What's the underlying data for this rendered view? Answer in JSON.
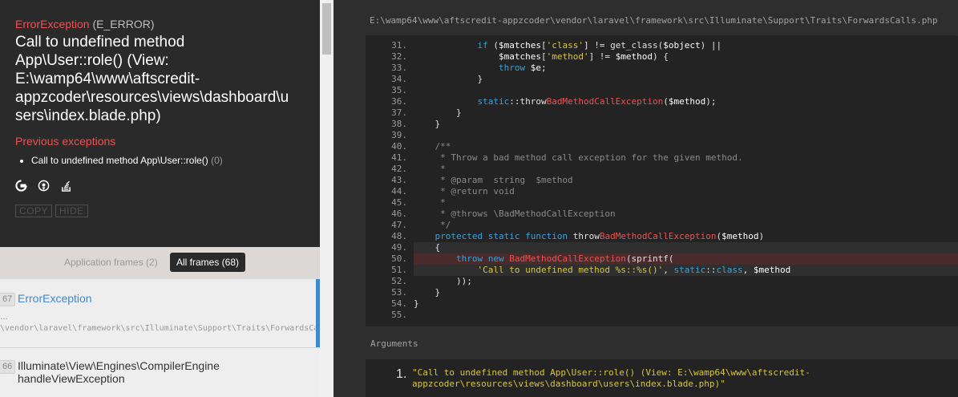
{
  "exception": {
    "class_name": "ErrorException",
    "severity": "(E_ERROR)",
    "message": "Call to undefined method App\\User::role() (View: E:\\wamp64\\www\\aftscredit-appzcoder\\resources\\views\\dashboard\\users\\index.blade.php)",
    "previous_title": "Previous exceptions",
    "previous": [
      {
        "text": "Call to undefined method App\\User::role()",
        "code": "(0)"
      }
    ],
    "search_icons": [
      "google-icon",
      "duckduckgo-icon",
      "stackoverflow-icon"
    ],
    "copy_label": "COPY",
    "hide_label": "HIDE"
  },
  "frames_controls": {
    "application_label": "Application frames (2)",
    "all_label": "All frames (68)"
  },
  "frames": [
    {
      "index": "67",
      "class": "ErrorException",
      "ellipsis": "…",
      "file": "\\vendor\\laravel\\framework\\src\\Illuminate\\Support\\Traits\\ForwardsCalls.php"
    },
    {
      "index": "66",
      "class": "Illuminate\\View\\Engines\\CompilerEngine",
      "function": "handleViewException"
    }
  ],
  "code": {
    "file_path": "E:\\wamp64\\www\\aftscredit-appzcoder\\vendor\\laravel\\framework\\src\\Illuminate\\Support\\Traits\\ForwardsCalls.php",
    "highlighted_line": 50,
    "lines": [
      {
        "n": "31.",
        "t": "            if ($matches['class'] != get_class($object) ||"
      },
      {
        "n": "32.",
        "t": "                $matches['method'] != $method) {"
      },
      {
        "n": "33.",
        "t": "                throw $e;"
      },
      {
        "n": "34.",
        "t": "            }"
      },
      {
        "n": "35.",
        "t": ""
      },
      {
        "n": "36.",
        "t": "            static::throwBadMethodCallException($method);"
      },
      {
        "n": "37.",
        "t": "        }"
      },
      {
        "n": "38.",
        "t": "    }"
      },
      {
        "n": "39.",
        "t": ""
      },
      {
        "n": "40.",
        "t": "    /**"
      },
      {
        "n": "41.",
        "t": "     * Throw a bad method call exception for the given method."
      },
      {
        "n": "42.",
        "t": "     *"
      },
      {
        "n": "43.",
        "t": "     * @param  string  $method"
      },
      {
        "n": "44.",
        "t": "     * @return void"
      },
      {
        "n": "45.",
        "t": "     *"
      },
      {
        "n": "46.",
        "t": "     * @throws \\BadMethodCallException"
      },
      {
        "n": "47.",
        "t": "     */"
      },
      {
        "n": "48.",
        "t": "    protected static function throwBadMethodCallException($method)"
      },
      {
        "n": "49.",
        "t": "    {"
      },
      {
        "n": "50.",
        "t": "        throw new BadMethodCallException(sprintf("
      },
      {
        "n": "51.",
        "t": "            'Call to undefined method %s::%s()', static::class, $method"
      },
      {
        "n": "52.",
        "t": "        ));"
      },
      {
        "n": "53.",
        "t": "    }"
      },
      {
        "n": "54.",
        "t": "}"
      },
      {
        "n": "55.",
        "t": ""
      }
    ]
  },
  "arguments": {
    "title": "Arguments",
    "items": [
      {
        "n": "1.",
        "line1": "\"Call to undefined method App\\User::role() (View: E:\\wamp64\\www\\aftscredit-",
        "line2": "appzcoder\\resources\\views\\dashboard\\users\\index.blade.php)\""
      }
    ]
  },
  "colors": {
    "accent_red": "#e95353",
    "accent_blue": "#4288ce",
    "string_yellow": "#d7c53e",
    "keyword_blue": "#3aa0d8"
  }
}
